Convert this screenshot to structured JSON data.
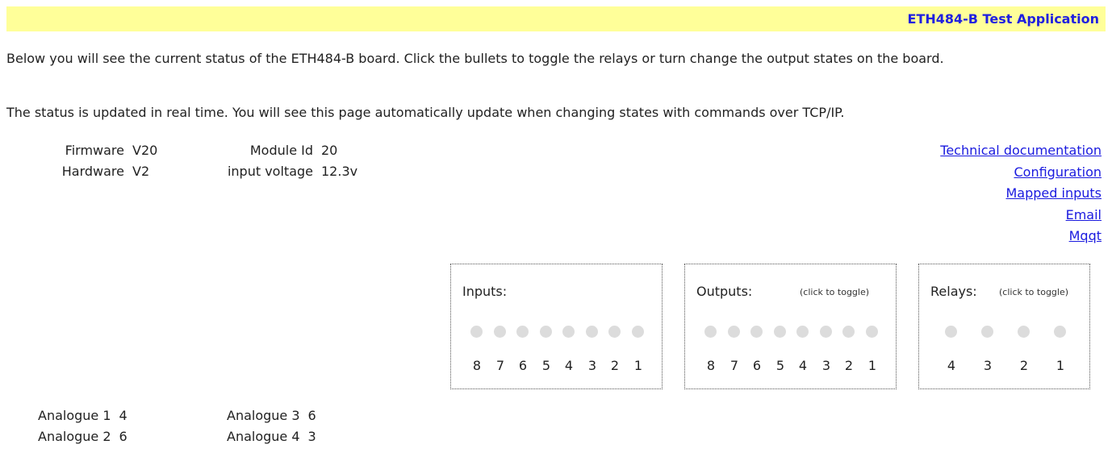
{
  "header": {
    "title": "ETH484-B Test Application"
  },
  "intro": {
    "line1": "Below you will see the current status of the ETH484-B board. Click the bullets to toggle the relays or turn change the output states on the board.",
    "line2": "The status is updated in real time. You will see this page automatically update when changing states with commands over TCP/IP."
  },
  "info": {
    "firmware_label": "Firmware",
    "firmware_value": "V20",
    "hardware_label": "Hardware",
    "hardware_value": "V2",
    "module_label": "Module Id",
    "module_value": "20",
    "voltage_label": "input voltage",
    "voltage_value": "12.3v"
  },
  "links": [
    "Technical documentation",
    "Configuration",
    "Mapped inputs",
    "Email",
    "Mqqt"
  ],
  "inputs": {
    "title": "Inputs:",
    "labels": [
      "8",
      "7",
      "6",
      "5",
      "4",
      "3",
      "2",
      "1"
    ]
  },
  "outputs": {
    "title": "Outputs:",
    "hint": "(click to toggle)",
    "labels": [
      "8",
      "7",
      "6",
      "5",
      "4",
      "3",
      "2",
      "1"
    ]
  },
  "relays": {
    "title": "Relays:",
    "hint": "(click to toggle)",
    "labels": [
      "4",
      "3",
      "2",
      "1"
    ]
  },
  "analogue": [
    {
      "label": "Analogue 1",
      "value": "4"
    },
    {
      "label": "Analogue 2",
      "value": "6"
    },
    {
      "label": "Analogue 3",
      "value": "6"
    },
    {
      "label": "Analogue 4",
      "value": "3"
    }
  ],
  "colors": {
    "header_bg": "#ffff99",
    "title": "#2020e0",
    "link": "#1a1adf",
    "dot": "#dcdcdc"
  }
}
